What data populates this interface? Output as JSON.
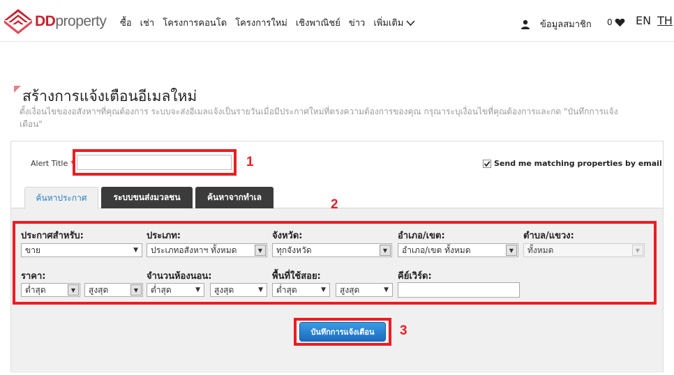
{
  "header": {
    "logo_text_dd": "DD",
    "logo_text_property": "property",
    "nav": [
      "ซื้อ",
      "เช่า",
      "โครงการคอนโด",
      "โครงการใหม่",
      "เชิงพาณิชย์",
      "ข่าว"
    ],
    "nav_more": "เพิ่มเติม",
    "member_label": "ข้อมูลสมาชิก",
    "favorites_count": "0",
    "lang_en": "EN",
    "lang_th": "TH"
  },
  "page": {
    "title": "สร้างการแจ้งเตือนอีเมลใหม่",
    "subtitle": "ตั้งเงื่อนไขของอสังหาฯที่คุณต้องการ ระบบจะส่งอีเมลแจ้งเป็นรายวันเมื่อมีประกาศใหม่ที่ตรงความต้องการของคุณ กรุณาระบุเงื่อนไขที่คุณต้องการและกด \"บันทึกการแจ้งเตือน\""
  },
  "form": {
    "alert_title_label": "Alert Title",
    "alert_title_required": "*",
    "alert_title_value": "",
    "email_checkbox_label": "Send me matching properties by email",
    "email_checked": true,
    "tabs": [
      "ค้นหาประกาศ",
      "ระบบขนส่งมวลชน",
      "ค้นหาจากทำเล"
    ],
    "fields": {
      "listing_for_label": "ประกาศสำหรับ:",
      "listing_for_value": "ขาย",
      "type_label": "ประเภท:",
      "type_value": "ประเภทอสังหาฯ ทั้งหมด",
      "province_label": "จังหวัด:",
      "province_value": "ทุกจังหวัด",
      "district_label": "อำเภอ/เขต:",
      "district_value": "อำเภอ/เขต ทั้งหมด",
      "subdistrict_label": "ตำบล/แขวง:",
      "subdistrict_value": "ทั้งหมด",
      "price_label": "ราคา:",
      "price_min": "ต่ำสุด",
      "price_max": "สูงสุด",
      "bedrooms_label": "จำนวนห้องนอน:",
      "bedrooms_min": "ต่ำสุด",
      "bedrooms_max": "สูงสุด",
      "area_label": "พื้นที่ใช้สอย:",
      "area_min": "ต่ำสุด",
      "area_max": "สูงสุด",
      "keyword_label": "คีย์เวิร์ด:",
      "keyword_value": ""
    },
    "save_button": "บันทึกการแจ้งเตือน"
  },
  "annotations": [
    "1",
    "2",
    "3"
  ],
  "colors": {
    "brand_red": "#c8202c",
    "annotation_red": "#ec1c24",
    "tab_active_text": "#2a7fc1",
    "button_blue": "#1a6cc0"
  }
}
